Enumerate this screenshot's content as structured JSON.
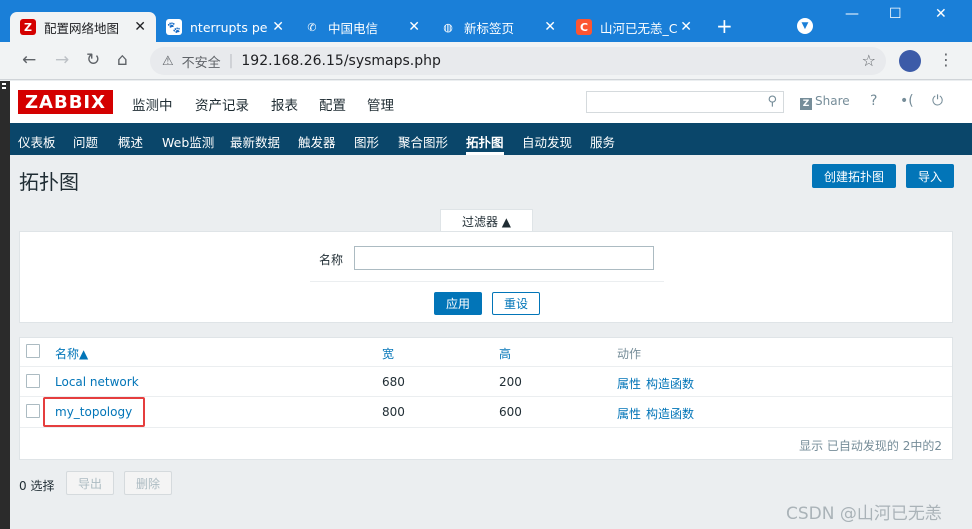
{
  "browser": {
    "tabs": [
      {
        "title": "配置网络地图",
        "favicon": "Z",
        "active": true
      },
      {
        "title": "nterrupts pe",
        "favicon": "paw"
      },
      {
        "title": "中国电信",
        "favicon": "telecom"
      },
      {
        "title": "新标签页",
        "favicon": "globe"
      },
      {
        "title": "山河已无恙_C",
        "favicon": "C"
      }
    ],
    "insecure_label": "不安全",
    "url": "192.168.26.15/sysmaps.php"
  },
  "header": {
    "logo": "ZABBIX",
    "menu": [
      "监测中",
      "资产记录",
      "报表",
      "配置",
      "管理"
    ],
    "share_label": "Share",
    "help": "?"
  },
  "subnav": [
    "仪表板",
    "问题",
    "概述",
    "Web监测",
    "最新数据",
    "触发器",
    "图形",
    "聚合图形",
    "拓扑图",
    "自动发现",
    "服务"
  ],
  "page": {
    "title": "拓扑图",
    "create_button": "创建拓扑图",
    "import_button": "导入"
  },
  "filter": {
    "tab_label": "过滤器 ▲",
    "name_label": "名称",
    "name_value": "",
    "apply_button": "应用",
    "reset_button": "重设"
  },
  "table": {
    "headers": {
      "name": "名称▲",
      "width": "宽",
      "height": "高",
      "actions": "动作"
    },
    "rows": [
      {
        "name": "Local network",
        "width": "680",
        "height": "200",
        "action1": "属性",
        "action2": "构造函数"
      },
      {
        "name": "my_topology",
        "width": "800",
        "height": "600",
        "action1": "属性",
        "action2": "构造函数"
      }
    ],
    "footer": "显示 已自动发现的 2中的2"
  },
  "bottom": {
    "selected": "0 选择",
    "export_button": "导出",
    "delete_button": "删除"
  },
  "watermark": "CSDN @山河已无恙",
  "colors": {
    "brand": "#d40000",
    "nav": "#0a466a",
    "link": "#0275b8",
    "highlight": "#e53e3e"
  }
}
